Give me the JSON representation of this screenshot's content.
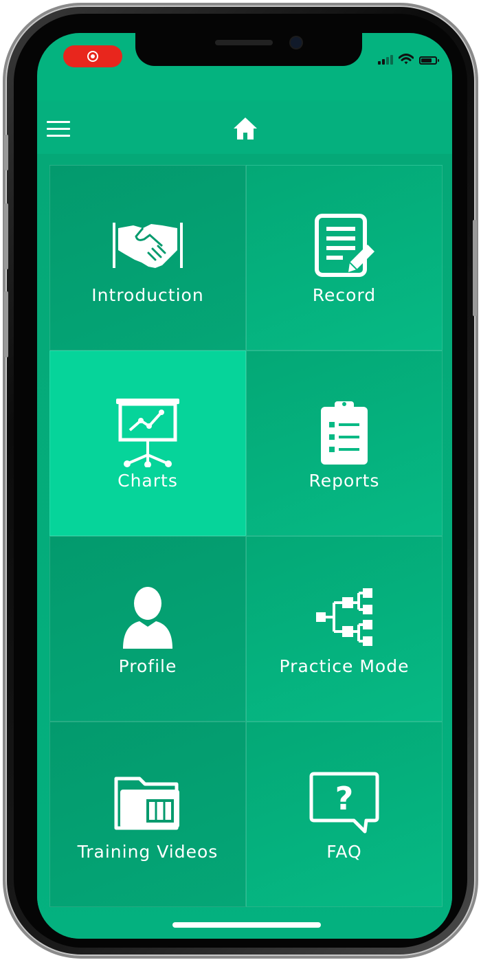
{
  "status_bar": {
    "recording_indicator": "record-icon",
    "icons": [
      "cellular-signal-icon",
      "wifi-icon",
      "battery-icon"
    ]
  },
  "nav": {
    "menu_icon": "hamburger-menu-icon",
    "home_icon": "home-icon"
  },
  "menu": [
    {
      "label": "Introduction",
      "icon": "handshake-icon"
    },
    {
      "label": "Record",
      "icon": "document-edit-icon"
    },
    {
      "label": "Charts",
      "icon": "presentation-chart-icon"
    },
    {
      "label": "Reports",
      "icon": "clipboard-checklist-icon"
    },
    {
      "label": "Profile",
      "icon": "user-icon"
    },
    {
      "label": "Practice Mode",
      "icon": "hierarchy-icon"
    },
    {
      "label": "Training Videos",
      "icon": "video-folder-icon"
    },
    {
      "label": "FAQ",
      "icon": "question-bubble-icon"
    }
  ],
  "colors": {
    "primary": "#04b37f",
    "tile_dark": "#039a6d",
    "tile_highlight": "#06d49a",
    "recording": "#e8261d",
    "text": "#ffffff"
  }
}
